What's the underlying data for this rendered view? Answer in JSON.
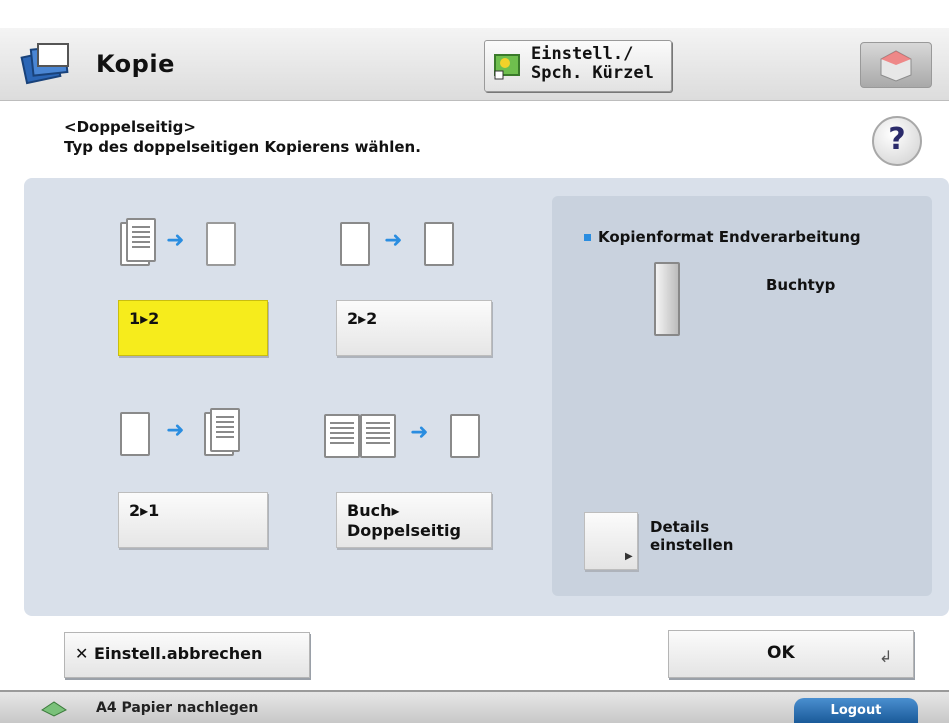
{
  "header": {
    "title": "Kopie",
    "shortcut_button": "Einstell./\nSpch. Kürzel"
  },
  "instruction": {
    "title": "<Doppelseitig>",
    "text": "Typ des doppelseitigen Kopierens wählen."
  },
  "options": [
    {
      "label": "1▸2",
      "selected": true
    },
    {
      "label": "2▸2",
      "selected": false
    },
    {
      "label": "2▸1",
      "selected": false
    },
    {
      "label": "Buch▸\nDoppelseitig",
      "selected": false
    }
  ],
  "finishing": {
    "title": "Kopienformat Endverarbeitung",
    "value": "Buchtyp",
    "details_label": "Details\neinstellen"
  },
  "buttons": {
    "cancel": "Einstell.abbrechen",
    "ok": "OK",
    "cancel_icon": "✕"
  },
  "status": {
    "text": "A4  Papier nachlegen",
    "logout": "Logout"
  },
  "colors": {
    "selected": "#f6ec1c",
    "accent": "#2a8de0"
  }
}
